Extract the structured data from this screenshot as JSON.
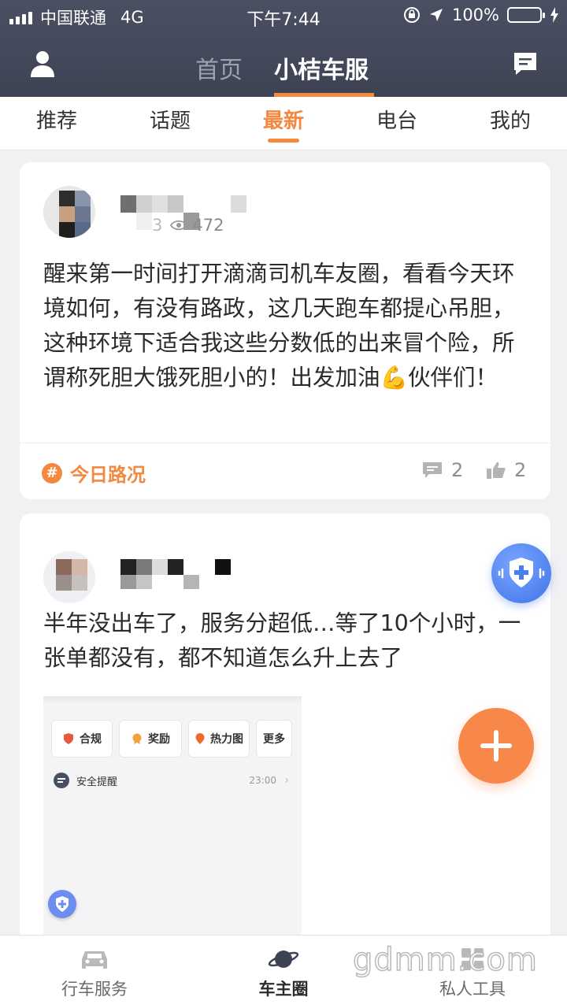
{
  "status_bar": {
    "carrier": "中国联通",
    "network": "4G",
    "time": "下午7:44",
    "battery": "100%"
  },
  "nav": {
    "home_tab": "首页",
    "brand_tab": "小桔车服"
  },
  "category_tabs": [
    {
      "label": "推荐",
      "active": false
    },
    {
      "label": "话题",
      "active": false
    },
    {
      "label": "最新",
      "active": true
    },
    {
      "label": "电台",
      "active": false
    },
    {
      "label": "我的",
      "active": false
    }
  ],
  "posts": [
    {
      "views_partial": "3",
      "views": "472",
      "text": "醒来第一时间打开滴滴司机车友圈，看看今天环境如何，有没有路政，这几天跑车都提心吊胆，这种环境下适合我这些分数低的出来冒个险，所谓称死胆大饿死胆小的！出发加油💪伙伴们！",
      "topic": "今日路况",
      "comments": "2",
      "likes": "2"
    },
    {
      "text": "半年没出车了，服务分超低…等了10个小时，一张单都没有，都不知道怎么升上去了",
      "embed": {
        "buttons": [
          "合规",
          "奖励",
          "热力图",
          "更多"
        ],
        "notice_label": "安全提醒",
        "notice_time": "23:00"
      }
    }
  ],
  "bottom_tabs": [
    {
      "label": "行车服务",
      "active": false
    },
    {
      "label": "车主圈",
      "active": true
    },
    {
      "label": "私人工具",
      "active": false
    }
  ],
  "watermark": "gdmm.com",
  "colors": {
    "accent": "#f3883e",
    "header": "#454a5c",
    "fab_blue": "#4a7ff0"
  }
}
